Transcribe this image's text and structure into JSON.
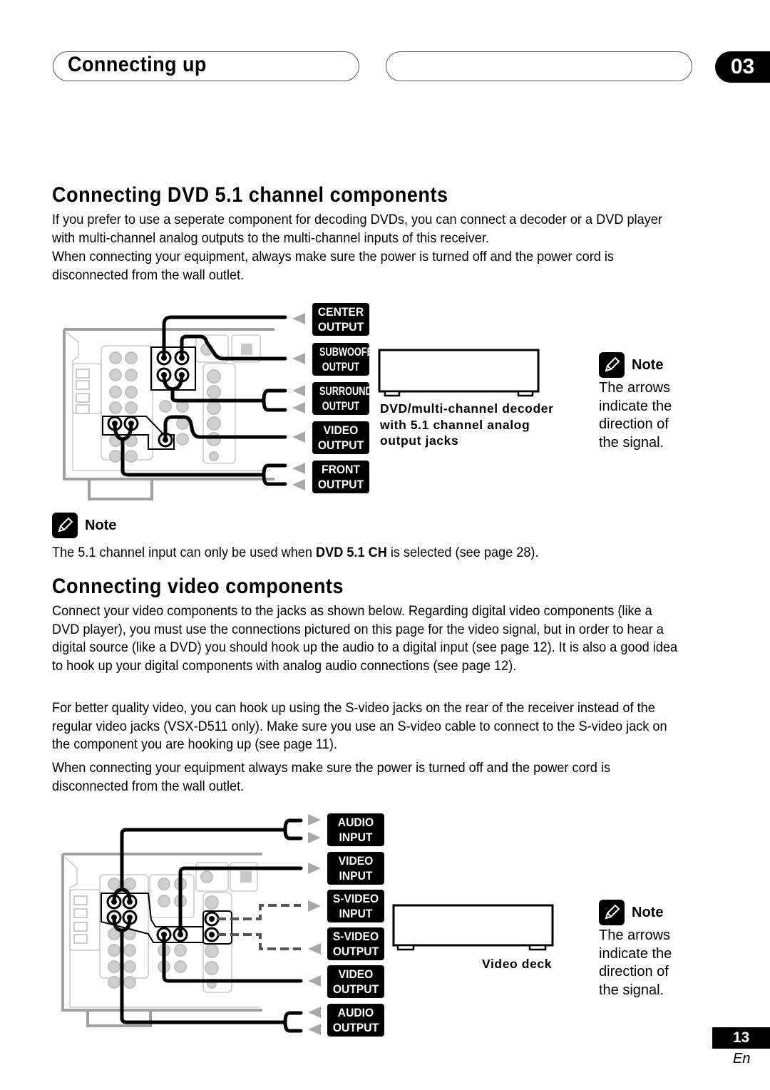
{
  "header": {
    "title": "Connecting up",
    "right_pill_text": "",
    "chapter": "03"
  },
  "section1": {
    "heading": "Connecting DVD 5.1 channel components",
    "paragraphs": [
      "If you prefer to use a seperate component for decoding DVDs, you can connect a decoder or a DVD player with multi-channel analog outputs to the multi-channel inputs of this receiver.",
      "When connecting your equipment, always make sure the power is turned off and the power cord is disconnected from the wall outlet."
    ],
    "diagram": {
      "labels": [
        {
          "line1": "CENTER",
          "line2": "OUTPUT",
          "arrows": 1,
          "direction": "left"
        },
        {
          "line1": "SUBWOOFER",
          "line2": "OUTPUT",
          "arrows": 1,
          "direction": "left"
        },
        {
          "line1": "SURROUND",
          "line2": "OUTPUT",
          "arrows": 2,
          "direction": "left"
        },
        {
          "line1": "VIDEO",
          "line2": "OUTPUT",
          "arrows": 1,
          "direction": "left"
        },
        {
          "line1": "FRONT",
          "line2": "OUTPUT",
          "arrows": 2,
          "direction": "left"
        }
      ],
      "device_caption": [
        "DVD/multi-channel decoder",
        "with 5.1 channel analog",
        "output jacks"
      ]
    },
    "side_note": {
      "label": "Note",
      "lines": [
        "The arrows",
        "indicate the",
        "direction of",
        "the signal."
      ]
    },
    "note": {
      "label": "Note",
      "text_before": "The 5.1 channel input can only be used when ",
      "text_bold": "DVD 5.1 CH",
      "text_after": " is selected (see page 28)."
    }
  },
  "section2": {
    "heading": "Connecting video components",
    "paragraphs": [
      "Connect your video components to the jacks as shown below. Regarding digital video components (like a DVD player), you must use the connections pictured on this page for the video signal, but in order to hear a digital source (like a DVD) you should hook up the audio to a digital input (see page 12). It is also a good idea to hook up your digital components with analog audio connections (see page 12).",
      "For better quality video, you can hook up using the S-video jacks on the rear of the receiver instead of the regular video jacks (VSX-D511 only). Make sure you use an S-video cable to connect to the S-video jack on the component you are hooking up (see page 11).",
      "When connecting your equipment always make sure the power is turned off and the power cord is disconnected from the wall outlet."
    ],
    "diagram": {
      "labels": [
        {
          "line1": "AUDIO",
          "line2": "INPUT",
          "arrows": 2,
          "direction": "right"
        },
        {
          "line1": "VIDEO",
          "line2": "INPUT",
          "arrows": 1,
          "direction": "right"
        },
        {
          "line1": "S-VIDEO",
          "line2": "INPUT",
          "arrows": 1,
          "direction": "right"
        },
        {
          "line1": "S-VIDEO",
          "line2": "OUTPUT",
          "arrows": 1,
          "direction": "left"
        },
        {
          "line1": "VIDEO",
          "line2": "OUTPUT",
          "arrows": 1,
          "direction": "left"
        },
        {
          "line1": "AUDIO",
          "line2": "OUTPUT",
          "arrows": 2,
          "direction": "left"
        }
      ],
      "device_caption": "Video deck"
    },
    "side_note": {
      "label": "Note",
      "lines": [
        "The arrows",
        "indicate the",
        "direction of",
        "the signal."
      ]
    }
  },
  "footer": {
    "page_number": "13",
    "language": "En"
  },
  "colors": {
    "ink": "#000000",
    "panel_gray": "#a0a0a0",
    "light_gray": "#c8c8c8",
    "arrow_gray": "#a8a8a8",
    "dash_gray": "#555555"
  }
}
